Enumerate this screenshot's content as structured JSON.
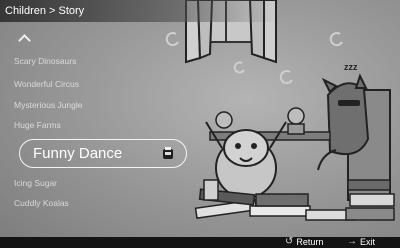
{
  "header": {
    "breadcrumb": "Children > Story"
  },
  "menu": {
    "items": [
      {
        "label": "Scary Dinosaurs"
      },
      {
        "label": "Wonderful Circus"
      },
      {
        "label": "Mysterious Jungle"
      },
      {
        "label": "Huge Farms"
      }
    ],
    "selected": {
      "label": "Funny Dance"
    },
    "items_after": [
      {
        "label": "Icing Sugar"
      },
      {
        "label": "Cuddly Koalas"
      }
    ]
  },
  "illustration": {
    "sleep_text": "zzz"
  },
  "footer": {
    "return_label": "Return",
    "return_icon": "return-arrow-icon",
    "exit_label": "Exit",
    "exit_icon": "exit-icon"
  },
  "colors": {
    "selection_border": "#f4f4f4",
    "footer_bg": "#141414"
  }
}
